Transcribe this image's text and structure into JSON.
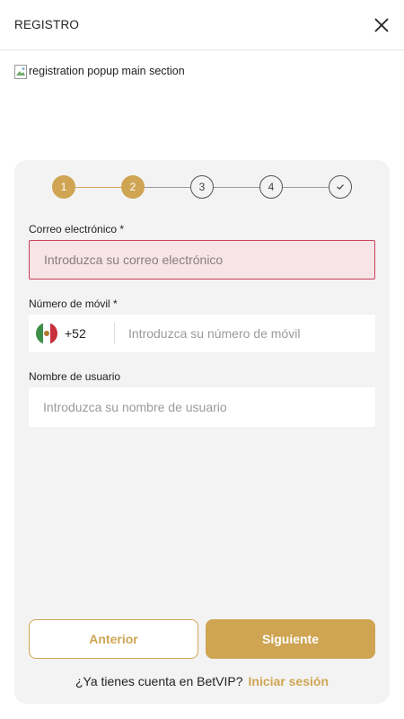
{
  "header": {
    "title": "REGISTRO",
    "close_icon": "close-icon"
  },
  "banner": {
    "alt_text": "registration popup main section"
  },
  "stepper": {
    "steps": [
      "1",
      "2",
      "3",
      "4",
      "✓"
    ],
    "current_step": 2,
    "accent_color": "#cfa553"
  },
  "form": {
    "email": {
      "label": "Correo electrónico *",
      "placeholder": "Introduzca su correo electrónico",
      "state": "error"
    },
    "phone": {
      "label": "Número de móvil *",
      "country_code": "+52",
      "flag_icon": "mexico-flag-icon",
      "placeholder": "Introduzca su número de móvil"
    },
    "username": {
      "label": "Nombre de usuario",
      "placeholder": "Introduzca su nombre de usuario"
    }
  },
  "buttons": {
    "prev_label": "Anterior",
    "next_label": "Siguiente"
  },
  "footer": {
    "question": "¿Ya tienes cuenta en BetVIP?",
    "login_label": "Iniciar sesión"
  },
  "colors": {
    "accent": "#cfa553",
    "error_border": "#c9405a",
    "error_bg": "#f6e4e6"
  }
}
